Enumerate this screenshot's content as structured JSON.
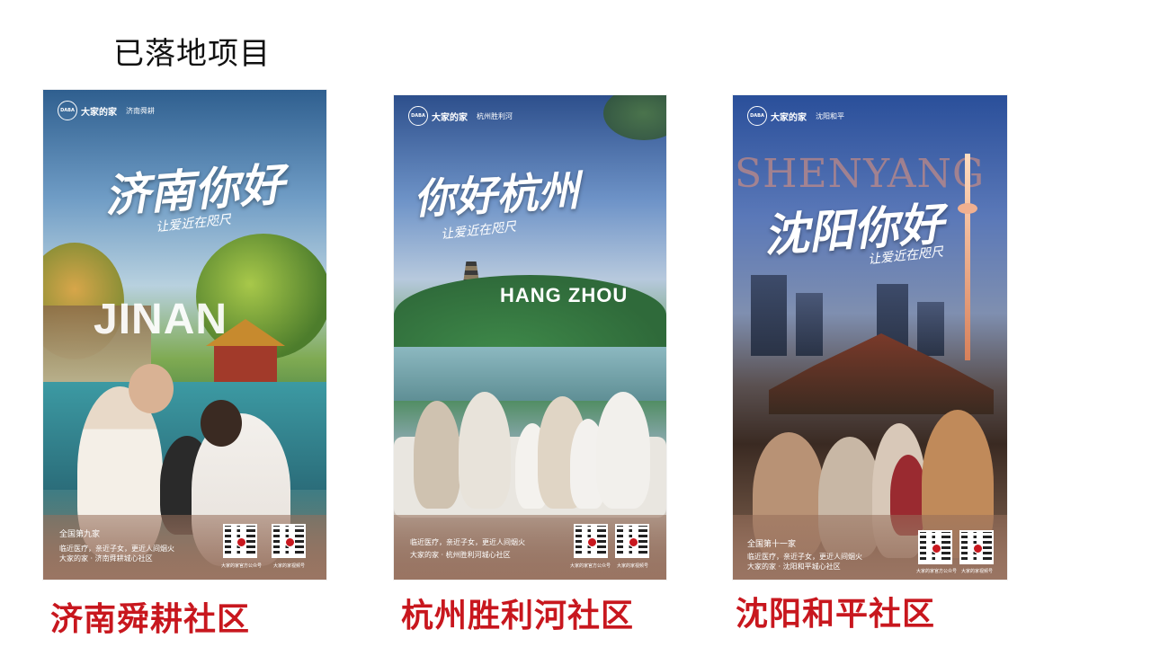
{
  "slide": {
    "title": "已落地项目"
  },
  "posters": [
    {
      "brand": "大家的家",
      "logo_text": "DABA",
      "sub_brand": "济南舜耕",
      "headline": "济南你好",
      "slogan": "让爱近在咫尺",
      "city_en": "JINAN",
      "rank": "全国第九家",
      "footer_line1": "临近医疗，亲近子女，更近人间烟火",
      "footer_line2": "大家的家 · 济南舜耕城心社区",
      "qr_label_1": "大家的家官方公众号",
      "qr_label_2": "大家的家视频号",
      "caption": "济南舜耕社区"
    },
    {
      "brand": "大家的家",
      "logo_text": "DABA",
      "sub_brand": "杭州胜利河",
      "headline": "你好杭州",
      "slogan": "让爱近在咫尺",
      "city_en": "HANG ZHOU",
      "rank": "",
      "footer_line1": "临近医疗，亲近子女，更近人间烟火",
      "footer_line2": "大家的家 · 杭州胜利河城心社区",
      "qr_label_1": "大家的家官方公众号",
      "qr_label_2": "大家的家视频号",
      "caption": "杭州胜利河社区"
    },
    {
      "brand": "大家的家",
      "logo_text": "DABA",
      "sub_brand": "沈阳和平",
      "headline": "沈阳你好",
      "slogan": "让爱近在咫尺",
      "city_en": "SHENYANG",
      "rank": "全国第十一家",
      "footer_line1": "临近医疗，亲近子女，更近人间烟火",
      "footer_line2": "大家的家 · 沈阳和平城心社区",
      "qr_label_1": "大家的家官方公众号",
      "qr_label_2": "大家的家视频号",
      "caption": "沈阳和平社区"
    }
  ]
}
